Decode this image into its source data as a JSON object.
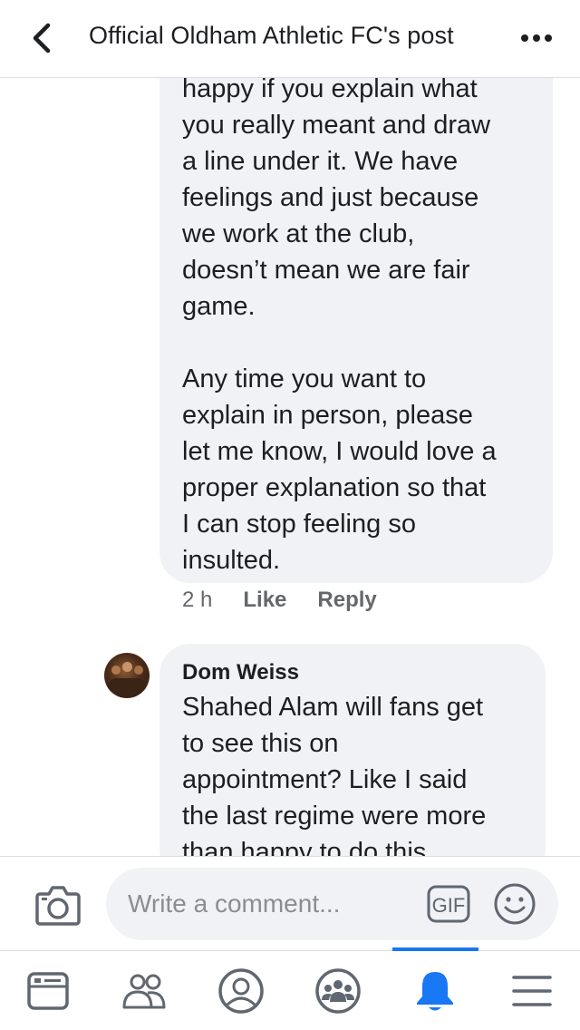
{
  "header": {
    "title": "Official Oldham Athletic FC's post",
    "back_icon": "chevron-left-icon",
    "more_icon": "more-horizontal-icon"
  },
  "comments": [
    {
      "text": "happy if you explain what\nyou really meant and draw\na line under it. We have\nfeelings and just because\nwe work at the club,\ndoesn’t mean we are fair\ngame.\n\nAny time you want to\nexplain in person, please\nlet me know, I would love a\nproper explanation so that\nI can stop feeling so\ninsulted.",
      "time": "2 h",
      "like_label": "Like",
      "reply_label": "Reply"
    },
    {
      "author": "Dom Weiss",
      "text": "Shahed Alam will fans get\nto see this on\nappointment? Like I said\nthe last regime were more\nthan happy to do this"
    }
  ],
  "composer": {
    "placeholder": "Write a comment...",
    "camera_icon": "camera-icon",
    "gif_label": "GIF",
    "emoji_icon": "emoji-icon"
  },
  "tabbar": {
    "items": [
      {
        "icon": "news-feed-icon",
        "active": false
      },
      {
        "icon": "friends-icon",
        "active": false
      },
      {
        "icon": "profile-icon",
        "active": false
      },
      {
        "icon": "groups-icon",
        "active": false
      },
      {
        "icon": "notifications-bell-icon",
        "active": true
      },
      {
        "icon": "menu-icon",
        "active": false
      }
    ]
  },
  "colors": {
    "accent": "#1877f2",
    "bubble": "#f0f2f5",
    "meta_text": "#65676b",
    "icon_gray": "#606770"
  }
}
